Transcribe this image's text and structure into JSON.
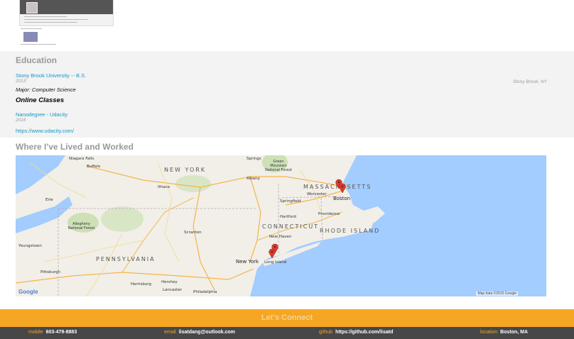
{
  "education": {
    "title": "Education",
    "schools": [
      {
        "name": "Stony Brook University -- B.S.",
        "date": "2013",
        "location": "Stony Brook, NY",
        "major": "Major: Computer Science"
      }
    ],
    "online_title": "Online Classes",
    "online": [
      {
        "title": "Nanodegree - Udacity",
        "date": "2016",
        "url": "https://www.udacity.com/"
      }
    ]
  },
  "map": {
    "title": "Where I've Lived and Worked",
    "states": [
      "NEW YORK",
      "MASSACHUSETTS",
      "CONNECTICUT",
      "RHODE ISLAND",
      "PENNSYLVANIA"
    ],
    "cities": {
      "niagara_falls": "Niagara Falls",
      "buffalo": "Buffalo",
      "erie": "Erie",
      "ithaca": "Ithaca",
      "albany": "Albany",
      "springs": "Springs",
      "worcester": "Worcester",
      "boston": "Boston",
      "springfield": "Springfield",
      "hartford": "Hartford",
      "providence": "Providence",
      "new_haven": "New Haven",
      "scranton": "Scranton",
      "youngstown": "Youngstown",
      "pittsburgh": "Pittsburgh",
      "harrisburg": "Harrisburg",
      "lancaster": "Lancaster",
      "philadelphia": "Philadelphia",
      "new_york": "New York",
      "long_island": "Long Island",
      "green_mountain": "Green Mountain National Forest",
      "allegheny": "Allegheny National Forest",
      "hershey": "Hershey"
    },
    "google": "Google",
    "attribution": "Map data ©2015 Google"
  },
  "footer": {
    "connect_title": "Let's Connect",
    "contacts": [
      {
        "label": "mobile",
        "value": "603-479-8883"
      },
      {
        "label": "email",
        "value": "lisatdang@outlook.com"
      },
      {
        "label": "github",
        "value": "https://github.com/lisatd"
      },
      {
        "label": "location",
        "value": "Boston, MA"
      }
    ]
  },
  "colors": {
    "accent": "#f5a623",
    "link": "#1199c4",
    "footer_bg": "#474747",
    "marker": "#d93b2b"
  },
  "icons": [
    "map-marker-icon"
  ]
}
